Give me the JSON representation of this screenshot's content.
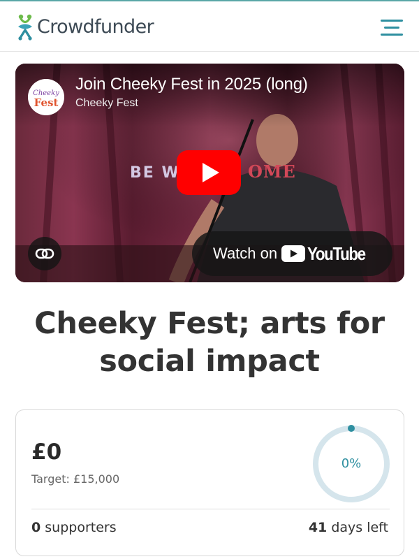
{
  "header": {
    "brand_name": "Crowdfunder",
    "brand_color": "#2e8fa0",
    "logo_icon": "crowdfunder-logo-icon",
    "menu_icon": "hamburger-menu-icon"
  },
  "video": {
    "title": "Join Cheeky Fest in 2025 (long)",
    "channel_name": "Cheeky Fest",
    "channel_avatar_text": "Cheeky Fest",
    "sign_text_left": "BE W",
    "sign_text_right": "OME",
    "watch_label": "Watch on",
    "platform_name": "YouTube",
    "play_icon": "play-icon",
    "copy_link_icon": "link-icon",
    "play_button_color": "#ff0000"
  },
  "campaign": {
    "title": "Cheeky Fest; arts for social impact"
  },
  "stats": {
    "amount_raised": "£0",
    "target_label": "Target: £15,000",
    "progress_label": "0%",
    "progress_fraction": 0,
    "supporters_count": "0",
    "supporters_label": "supporters",
    "days_count": "41",
    "days_label": "days left"
  }
}
